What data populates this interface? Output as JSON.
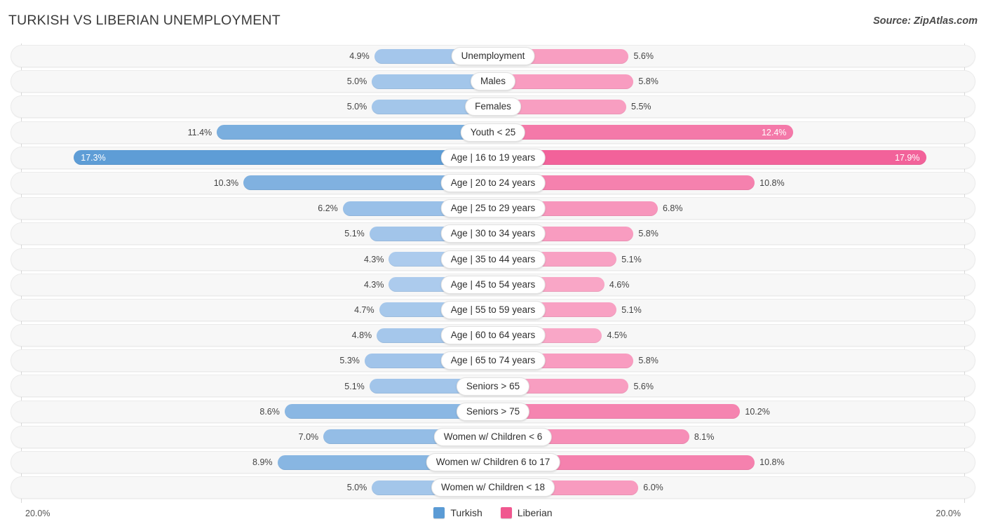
{
  "header": {
    "title": "TURKISH VS LIBERIAN UNEMPLOYMENT",
    "source": "Source: ZipAtlas.com"
  },
  "axis": {
    "left_label": "20.0%",
    "right_label": "20.0%"
  },
  "legend": {
    "items": [
      {
        "label": "Turkish",
        "color": "#5b9bd5"
      },
      {
        "label": "Liberian",
        "color": "#f0588f"
      }
    ]
  },
  "colors": {
    "left_series_base": "#5b9bd5",
    "right_series_base": "#f0588f",
    "track": "#f7f7f7",
    "gridline": "#d8d8d8"
  },
  "chart_data": {
    "type": "bar",
    "subtype": "diverging-butterfly",
    "title": "TURKISH VS LIBERIAN UNEMPLOYMENT",
    "xlabel": "",
    "ylabel": "",
    "axis_max_percent": 20.0,
    "xlim": [
      20.0,
      20.0
    ],
    "grid": true,
    "legend_position": "bottom-center",
    "categories": [
      "Unemployment",
      "Males",
      "Females",
      "Youth < 25",
      "Age | 16 to 19 years",
      "Age | 20 to 24 years",
      "Age | 25 to 29 years",
      "Age | 30 to 34 years",
      "Age | 35 to 44 years",
      "Age | 45 to 54 years",
      "Age | 55 to 59 years",
      "Age | 60 to 64 years",
      "Age | 65 to 74 years",
      "Seniors > 65",
      "Seniors > 75",
      "Women w/ Children < 6",
      "Women w/ Children 6 to 17",
      "Women w/ Children < 18"
    ],
    "series": [
      {
        "name": "Turkish",
        "side": "left",
        "color": "#5b9bd5",
        "values": [
          4.9,
          5.0,
          5.0,
          11.4,
          17.3,
          10.3,
          6.2,
          5.1,
          4.3,
          4.3,
          4.7,
          4.8,
          5.3,
          5.1,
          8.6,
          7.0,
          8.9,
          5.0
        ],
        "labels": [
          "4.9%",
          "5.0%",
          "5.0%",
          "11.4%",
          "17.3%",
          "10.3%",
          "6.2%",
          "5.1%",
          "4.3%",
          "4.3%",
          "4.7%",
          "4.8%",
          "5.3%",
          "5.1%",
          "8.6%",
          "7.0%",
          "8.9%",
          "5.0%"
        ]
      },
      {
        "name": "Liberian",
        "side": "right",
        "color": "#f0588f",
        "values": [
          5.6,
          5.8,
          5.5,
          12.4,
          17.9,
          10.8,
          6.8,
          5.8,
          5.1,
          4.6,
          5.1,
          4.5,
          5.8,
          5.6,
          10.2,
          8.1,
          10.8,
          6.0
        ],
        "labels": [
          "5.6%",
          "5.8%",
          "5.5%",
          "12.4%",
          "17.9%",
          "10.8%",
          "6.8%",
          "5.8%",
          "5.1%",
          "4.6%",
          "5.1%",
          "4.5%",
          "5.8%",
          "5.6%",
          "10.2%",
          "8.1%",
          "10.8%",
          "6.0%"
        ]
      }
    ],
    "rows": [
      {
        "category": "Unemployment",
        "left_value": 4.9,
        "left_label": "4.9%",
        "right_value": 5.6,
        "right_label": "5.6%"
      },
      {
        "category": "Males",
        "left_value": 5.0,
        "left_label": "5.0%",
        "right_value": 5.8,
        "right_label": "5.8%"
      },
      {
        "category": "Females",
        "left_value": 5.0,
        "left_label": "5.0%",
        "right_value": 5.5,
        "right_label": "5.5%"
      },
      {
        "category": "Youth < 25",
        "left_value": 11.4,
        "left_label": "11.4%",
        "right_value": 12.4,
        "right_label": "12.4%"
      },
      {
        "category": "Age | 16 to 19 years",
        "left_value": 17.3,
        "left_label": "17.3%",
        "right_value": 17.9,
        "right_label": "17.9%"
      },
      {
        "category": "Age | 20 to 24 years",
        "left_value": 10.3,
        "left_label": "10.3%",
        "right_value": 10.8,
        "right_label": "10.8%"
      },
      {
        "category": "Age | 25 to 29 years",
        "left_value": 6.2,
        "left_label": "6.2%",
        "right_value": 6.8,
        "right_label": "6.8%"
      },
      {
        "category": "Age | 30 to 34 years",
        "left_value": 5.1,
        "left_label": "5.1%",
        "right_value": 5.8,
        "right_label": "5.8%"
      },
      {
        "category": "Age | 35 to 44 years",
        "left_value": 4.3,
        "left_label": "4.3%",
        "right_value": 5.1,
        "right_label": "5.1%"
      },
      {
        "category": "Age | 45 to 54 years",
        "left_value": 4.3,
        "left_label": "4.3%",
        "right_value": 4.6,
        "right_label": "4.6%"
      },
      {
        "category": "Age | 55 to 59 years",
        "left_value": 4.7,
        "left_label": "4.7%",
        "right_value": 5.1,
        "right_label": "5.1%"
      },
      {
        "category": "Age | 60 to 64 years",
        "left_value": 4.8,
        "left_label": "4.8%",
        "right_value": 4.5,
        "right_label": "4.5%"
      },
      {
        "category": "Age | 65 to 74 years",
        "left_value": 5.3,
        "left_label": "5.3%",
        "right_value": 5.8,
        "right_label": "5.8%"
      },
      {
        "category": "Seniors > 65",
        "left_value": 5.1,
        "left_label": "5.1%",
        "right_value": 5.6,
        "right_label": "5.6%"
      },
      {
        "category": "Seniors > 75",
        "left_value": 8.6,
        "left_label": "8.6%",
        "right_value": 10.2,
        "right_label": "10.2%"
      },
      {
        "category": "Women w/ Children < 6",
        "left_value": 7.0,
        "left_label": "7.0%",
        "right_value": 8.1,
        "right_label": "8.1%"
      },
      {
        "category": "Women w/ Children 6 to 17",
        "left_value": 8.9,
        "left_label": "8.9%",
        "right_value": 10.8,
        "right_label": "10.8%"
      },
      {
        "category": "Women w/ Children < 18",
        "left_value": 5.0,
        "left_label": "5.0%",
        "right_value": 6.0,
        "right_label": "6.0%"
      }
    ]
  }
}
